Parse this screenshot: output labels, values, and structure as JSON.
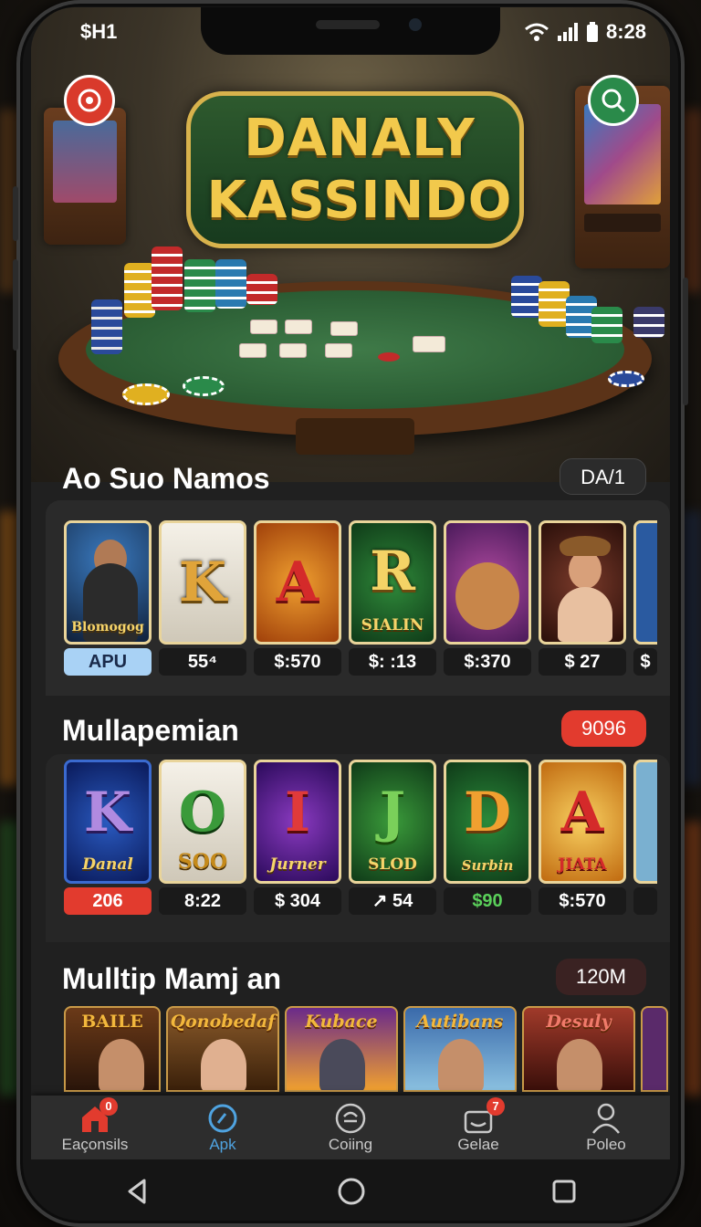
{
  "status_bar": {
    "left_text": "$H1",
    "time": "8:28"
  },
  "hero": {
    "logo_line1": "DANALY",
    "logo_line2": "KASSINDO"
  },
  "section1": {
    "title": "Ao Suo Namos",
    "badge": "DA/1",
    "tiles": [
      {
        "art_text": "Blomogog",
        "price": "APU",
        "style": "person"
      },
      {
        "letter": "K",
        "price": "55⁴",
        "style": "white"
      },
      {
        "letter": "A",
        "price": "$:570",
        "style": "orange"
      },
      {
        "letter": "R",
        "sub": "SIALIN",
        "price": "$: :13",
        "style": "green"
      },
      {
        "price": "$:370",
        "style": "bear"
      },
      {
        "price": "$ 27",
        "style": "woman"
      },
      {
        "price": "$",
        "style": "partial"
      }
    ]
  },
  "section2": {
    "title": "Mullapemian",
    "badge": "9096",
    "tiles": [
      {
        "letter": "K",
        "sub": "Danal",
        "price": "206",
        "style": "blue"
      },
      {
        "letter": "O",
        "sub": "SOO",
        "price": "8:22",
        "style": "white"
      },
      {
        "letter": "I",
        "sub": "Jurner",
        "price": "$ 304",
        "style": "purple"
      },
      {
        "letter": "J",
        "sub": "SLOD",
        "price": "↗ 54",
        "style": "green"
      },
      {
        "letter": "D",
        "sub": "Surbin",
        "price": "$90",
        "style": "green2"
      },
      {
        "letter": "A",
        "sub": "JIATA",
        "price": "$:570",
        "style": "gold"
      }
    ]
  },
  "section3": {
    "title": "Mulltip Mamj an",
    "badge": "120M",
    "banners": [
      {
        "title": "BAILE",
        "bg": "#6b3a18"
      },
      {
        "title": "Qonobedaf",
        "bg": "#7a4a1e"
      },
      {
        "title": "Kubace",
        "bg": "#4a2a5a"
      },
      {
        "title": "Autibans",
        "bg": "#2d4a7a"
      },
      {
        "title": "Desuly",
        "bg": "#7a2d25"
      }
    ]
  },
  "bottom_nav": [
    {
      "label": "Eaçonsils",
      "icon": "home-icon",
      "badge": "0",
      "active": false
    },
    {
      "label": "Apk",
      "icon": "compass-icon",
      "active": true
    },
    {
      "label": "Coiing",
      "icon": "coin-icon",
      "active": false
    },
    {
      "label": "Gelae",
      "icon": "gift-icon",
      "badge": "7",
      "active": false
    },
    {
      "label": "Poleo",
      "icon": "profile-icon",
      "active": false
    }
  ],
  "colors": {
    "accent_red": "#e23b2e",
    "accent_blue": "#4fa3e0",
    "gold": "#f2c94c"
  }
}
